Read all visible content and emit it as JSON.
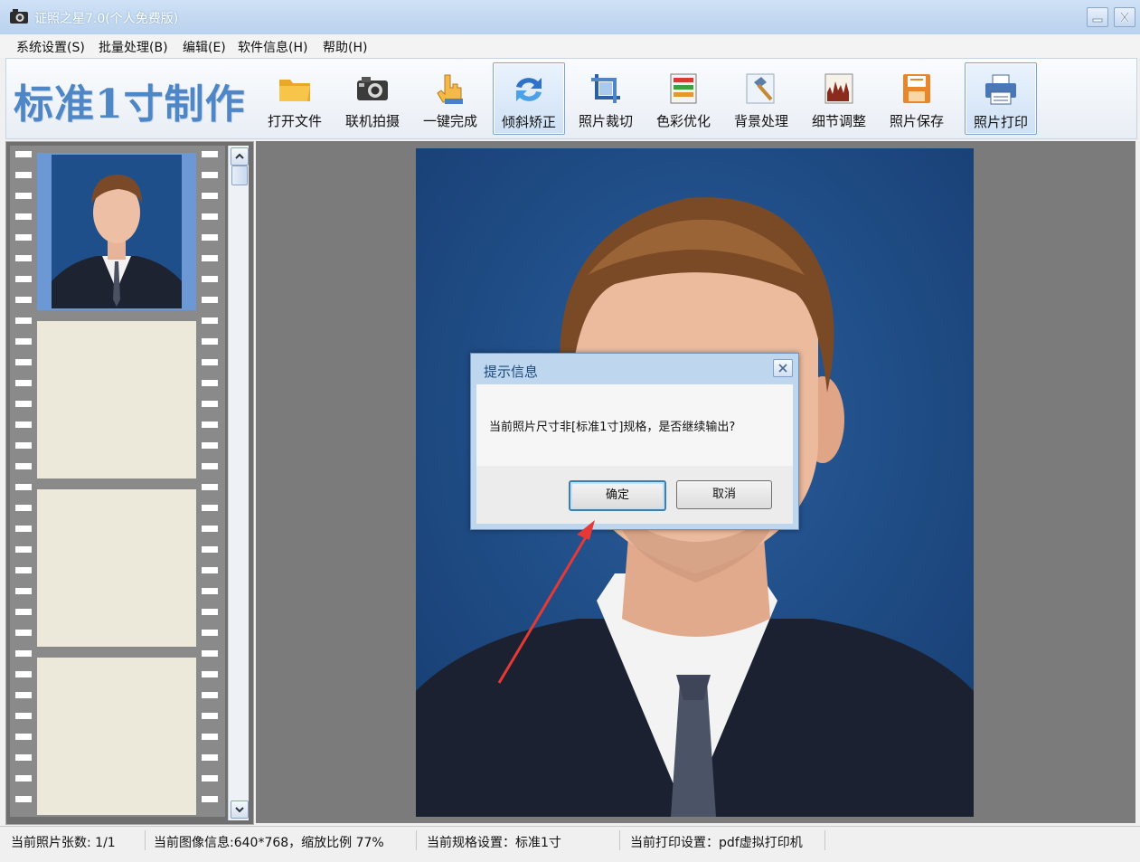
{
  "window": {
    "title": "证照之星7.0(个人免费版)"
  },
  "menu": [
    "系统设置(S)",
    "批量处理(B)",
    "编辑(E)",
    "软件信息(H)",
    "帮助(H)"
  ],
  "toolbar": {
    "brand": "标准1寸制作",
    "tools": [
      {
        "label": "打开文件",
        "icon": "folder-icon"
      },
      {
        "label": "联机拍摄",
        "icon": "camera-icon"
      },
      {
        "label": "一键完成",
        "icon": "hand-pointer-icon"
      },
      {
        "label": "倾斜矫正",
        "icon": "rotate-arrows-icon",
        "active": true
      },
      {
        "label": "照片裁切",
        "icon": "crop-icon"
      },
      {
        "label": "色彩优化",
        "icon": "color-bars-icon"
      },
      {
        "label": "背景处理",
        "icon": "hammer-icon"
      },
      {
        "label": "细节调整",
        "icon": "histogram-icon"
      },
      {
        "label": "照片保存",
        "icon": "floppy-disk-icon"
      },
      {
        "label": "照片打印",
        "icon": "printer-icon",
        "active": true
      }
    ]
  },
  "dialog": {
    "title": "提示信息",
    "message": "当前照片尺寸非[标准1寸]规格，是否继续输出?",
    "ok": "确定",
    "cancel": "取消"
  },
  "status": {
    "count": "当前照片张数: 1/1",
    "image_info": "当前图像信息:640*768，缩放比例 77%",
    "spec": "当前规格设置：标准1寸",
    "print": "当前打印设置：pdf虚拟打印机"
  },
  "colors": {
    "photo_background": "#1f4f8a",
    "film_selected": "#6c98d6",
    "brand": "#4f86c6",
    "arrow": "#e53935"
  }
}
